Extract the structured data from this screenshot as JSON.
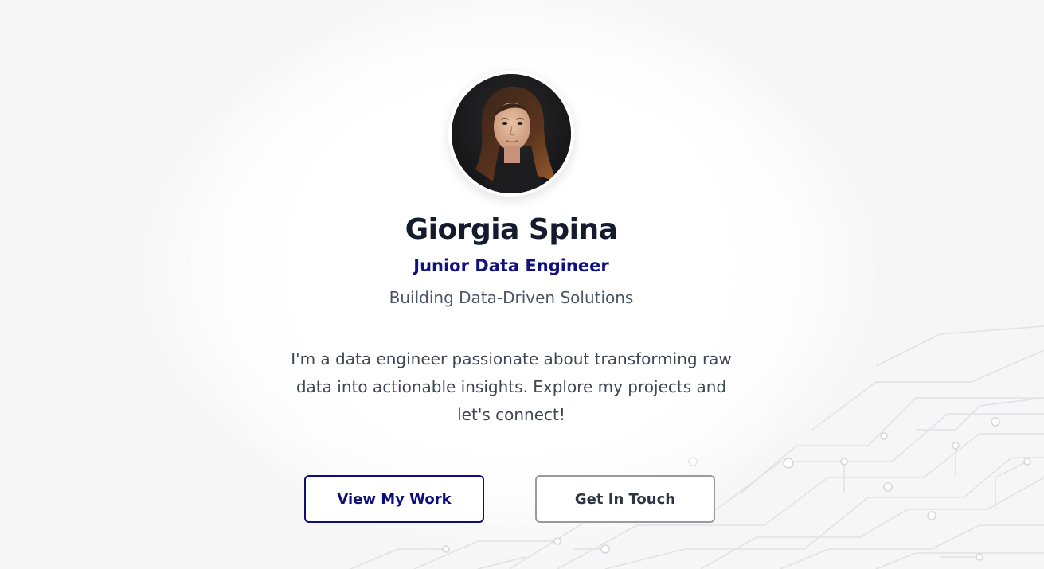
{
  "profile": {
    "name": "Giorgia Spina",
    "role": "Junior Data Engineer",
    "tagline": "Building Data-Driven Solutions",
    "bio": "I'm a data engineer passionate about transforming raw data into actionable insights. Explore my projects and let's connect!"
  },
  "actions": {
    "primary_label": "View My Work",
    "secondary_label": "Get In Touch"
  },
  "colors": {
    "primary": "#0e0e7a",
    "text_dark": "#141b2d",
    "text_muted": "#4b5563",
    "secondary_border": "#9a9a9e"
  }
}
